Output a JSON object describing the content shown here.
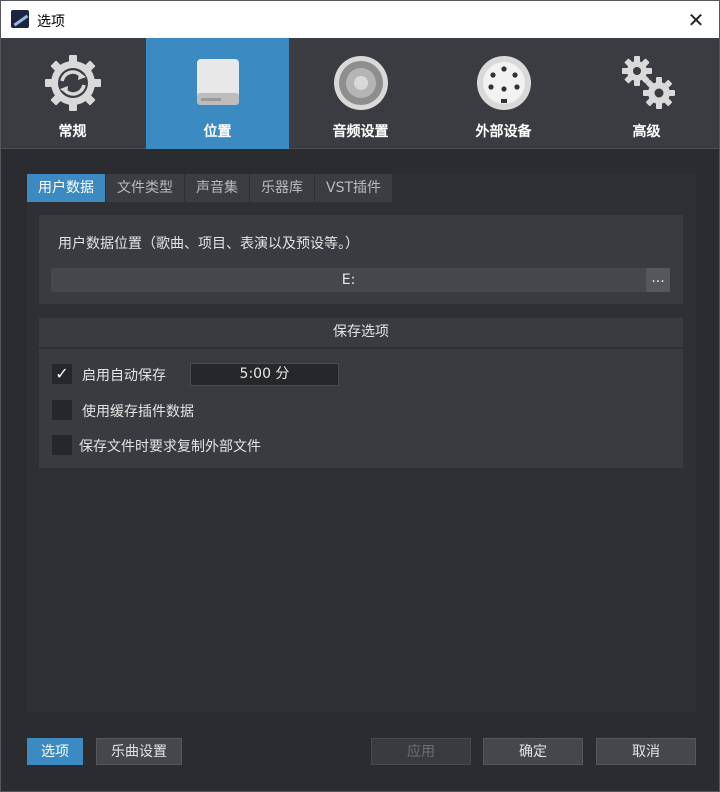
{
  "window": {
    "title": "选项",
    "close_glyph": "✕"
  },
  "categories": [
    {
      "label": "常规",
      "icon": "sync-gear-icon"
    },
    {
      "label": "位置",
      "icon": "hard-drive-icon",
      "active": true
    },
    {
      "label": "音频设置",
      "icon": "speaker-icon"
    },
    {
      "label": "外部设备",
      "icon": "midi-port-icon"
    },
    {
      "label": "高级",
      "icon": "gears-icon"
    }
  ],
  "subtabs": [
    {
      "label": "用户数据",
      "active": true
    },
    {
      "label": "文件类型"
    },
    {
      "label": "声音集"
    },
    {
      "label": "乐器库"
    },
    {
      "label": "VST插件"
    }
  ],
  "user_data": {
    "label": "用户数据位置（歌曲、项目、表演以及预设等。）",
    "path_value": "E:",
    "browse_label": "..."
  },
  "save_options": {
    "header": "保存选项",
    "autosave": {
      "label": "启用自动保存",
      "checked": true,
      "check_glyph": "✓",
      "interval": "5:00 分"
    },
    "cache_plugin": {
      "label": "使用缓存插件数据",
      "checked": false
    },
    "copy_external": {
      "label": "保存文件时要求复制外部文件",
      "checked": false
    }
  },
  "footer": {
    "options_label": "选项",
    "song_settings_label": "乐曲设置",
    "apply_label": "应用",
    "ok_label": "确定",
    "cancel_label": "取消"
  },
  "colors": {
    "accent": "#3b8ac2",
    "background": "#2b2c30",
    "panel": "#3a3b40"
  }
}
